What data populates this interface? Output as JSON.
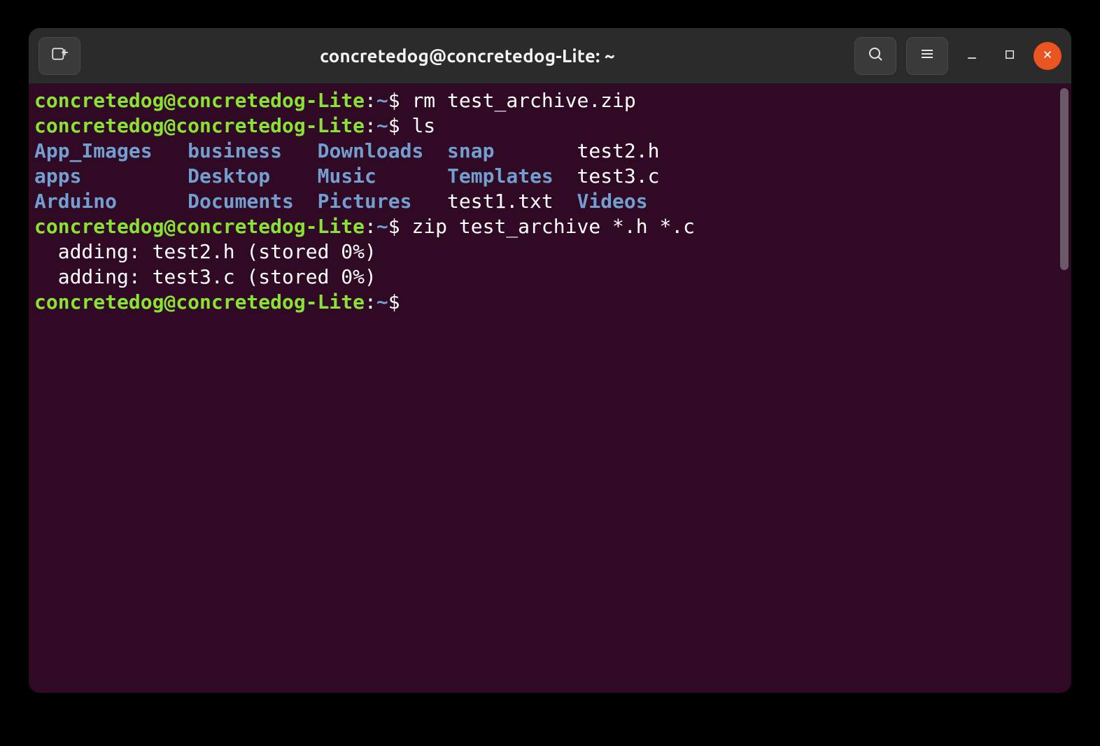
{
  "header": {
    "title": "concretedog@concretedog-Lite: ~"
  },
  "prompt": {
    "user": "concretedog@concretedog-Lite",
    "sep": ":",
    "path": "~",
    "symbol": "$"
  },
  "lines": {
    "cmd1": "rm test_archive.zip",
    "cmd2": "ls",
    "ls_row1": {
      "c0": "App_Images",
      "c1": "business",
      "c2": "Downloads",
      "c3": "snap",
      "c4": "test2.h"
    },
    "ls_row2": {
      "c0": "apps",
      "c1": "Desktop",
      "c2": "Music",
      "c3": "Templates",
      "c4": "test3.c"
    },
    "ls_row3": {
      "c0": "Arduino",
      "c1": "Documents",
      "c2": "Pictures",
      "c3": "test1.txt",
      "c4": "Videos"
    },
    "cmd3": "zip test_archive *.h *.c",
    "zip_out1": "  adding: test2.h (stored 0%)",
    "zip_out2": "  adding: test3.c (stored 0%)"
  },
  "icons": {
    "new_tab": "new-tab-icon",
    "search": "search-icon",
    "menu": "hamburger-menu-icon",
    "minimize": "minimize-icon",
    "maximize": "maximize-icon",
    "close": "close-icon"
  }
}
